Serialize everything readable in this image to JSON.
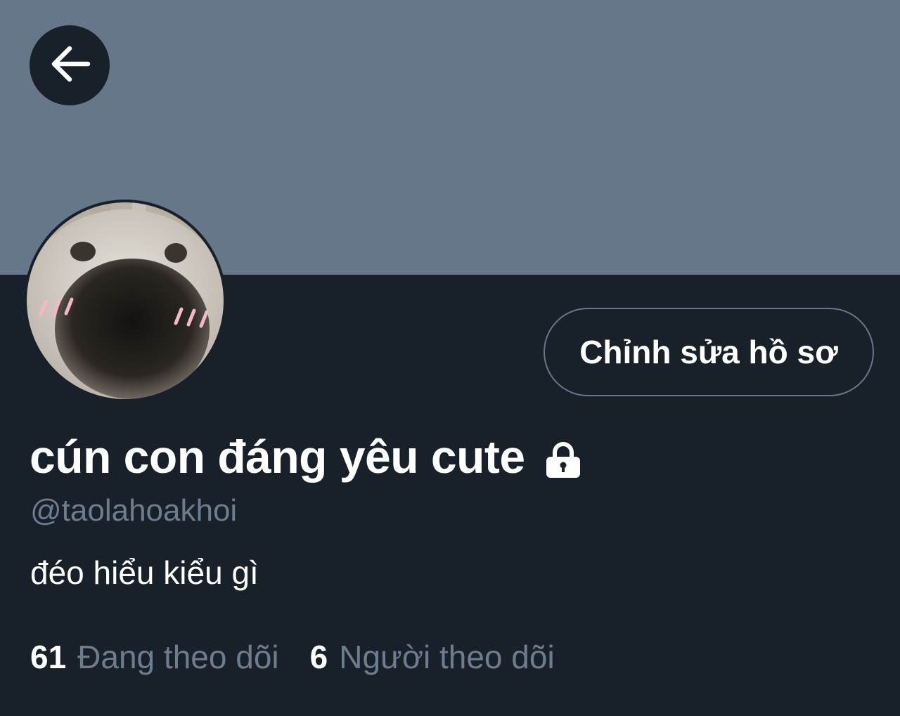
{
  "header": {
    "back_icon": "arrow-left-icon",
    "banner_color": "#66778a"
  },
  "profile": {
    "avatar": "puppy-closeup-avatar",
    "edit_label": "Chỉnh sửa hồ sơ",
    "display_name": "cún con đáng yêu cute",
    "lock_icon": "lock-icon",
    "handle": "@taolahoakhoi",
    "bio": "đéo hiểu kiểu gì"
  },
  "stats": {
    "following_count": "61",
    "following_label": "Đang theo dõi",
    "followers_count": "6",
    "followers_label": "Người theo dõi"
  },
  "colors": {
    "background": "#18202a",
    "text_primary": "#ffffff",
    "text_secondary": "#6d7d8e"
  }
}
